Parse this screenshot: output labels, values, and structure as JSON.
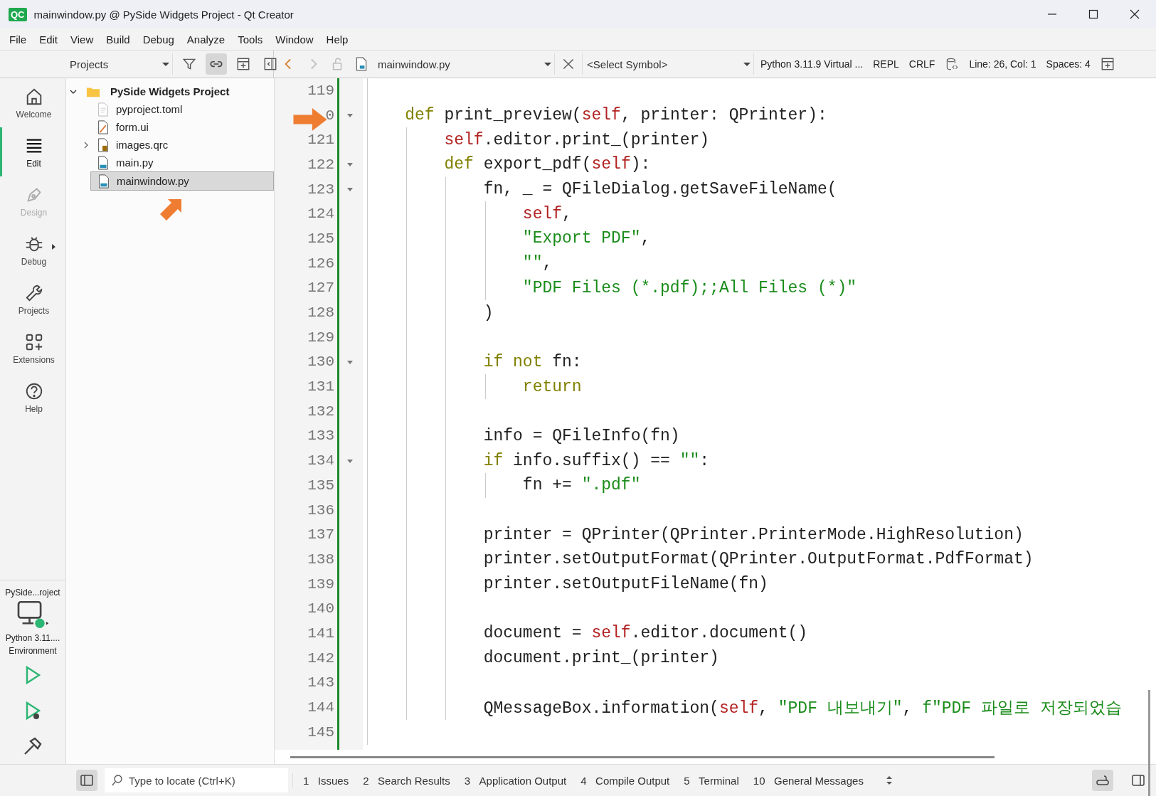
{
  "window": {
    "logo": "QC",
    "title": "mainwindow.py @ PySide Widgets Project - Qt Creator"
  },
  "menu": [
    "File",
    "Edit",
    "View",
    "Build",
    "Debug",
    "Analyze",
    "Tools",
    "Window",
    "Help"
  ],
  "project_toolbar": {
    "view": "Projects"
  },
  "editor_toolbar": {
    "file": "mainwindow.py",
    "symbol": "<Select Symbol>",
    "interpreter": "Python 3.11.9 Virtual ...",
    "repl": "REPL",
    "line_ending": "CRLF",
    "position": "Line: 26, Col: 1",
    "indentation": "Spaces: 4"
  },
  "modes": [
    {
      "label": "Welcome",
      "selected": false,
      "disabled": false,
      "menu": false
    },
    {
      "label": "Edit",
      "selected": true,
      "disabled": false,
      "menu": false
    },
    {
      "label": "Design",
      "selected": false,
      "disabled": true,
      "menu": false
    },
    {
      "label": "Debug",
      "selected": false,
      "disabled": false,
      "menu": true
    },
    {
      "label": "Projects",
      "selected": false,
      "disabled": false,
      "menu": false
    },
    {
      "label": "Extensions",
      "selected": false,
      "disabled": false,
      "menu": false
    },
    {
      "label": "Help",
      "selected": false,
      "disabled": false,
      "menu": false
    }
  ],
  "kit": {
    "project": "PySide...roject",
    "environment": "Python 3.11.... Environment"
  },
  "tree": {
    "label": "PySide Widgets Project",
    "expanded": true,
    "children": [
      {
        "label": "pyproject.toml",
        "kind": "toml",
        "collapsed": false,
        "selected": false
      },
      {
        "label": "form.ui",
        "kind": "ui",
        "collapsed": false,
        "selected": false
      },
      {
        "label": "images.qrc",
        "kind": "qrc",
        "collapsed": true,
        "selected": false
      },
      {
        "label": "main.py",
        "kind": "py",
        "collapsed": false,
        "selected": false
      },
      {
        "label": "mainwindow.py",
        "kind": "py",
        "collapsed": false,
        "selected": true
      }
    ]
  },
  "code": [
    {
      "number": "119",
      "fold": false
    },
    {
      "number": "0",
      "fold": true,
      "tokens": [
        {
          "kind": "keyword",
          "text": "    def"
        },
        {
          "kind": "plain",
          "text": " print_preview("
        },
        {
          "kind": "self",
          "text": "self"
        },
        {
          "kind": "plain",
          "text": ", printer: QPrinter):"
        }
      ]
    },
    {
      "number": "121",
      "fold": false,
      "tokens": [
        {
          "kind": "self",
          "text": "        self"
        },
        {
          "kind": "plain",
          "text": ".editor.print_(printer)"
        }
      ]
    },
    {
      "number": "122",
      "fold": true,
      "tokens": [
        {
          "kind": "keyword",
          "text": "        def"
        },
        {
          "kind": "plain",
          "text": " export_pdf("
        },
        {
          "kind": "self",
          "text": "self"
        },
        {
          "kind": "plain",
          "text": "):"
        }
      ]
    },
    {
      "number": "123",
      "fold": true,
      "tokens": [
        {
          "kind": "plain",
          "text": "            fn, _ = QFileDialog.getSaveFileName("
        }
      ]
    },
    {
      "number": "124",
      "fold": false,
      "tokens": [
        {
          "kind": "self",
          "text": "                self"
        },
        {
          "kind": "plain",
          "text": ","
        }
      ]
    },
    {
      "number": "125",
      "fold": false,
      "tokens": [
        {
          "kind": "string",
          "text": "                \"Export PDF\""
        },
        {
          "kind": "plain",
          "text": ","
        }
      ]
    },
    {
      "number": "126",
      "fold": false,
      "tokens": [
        {
          "kind": "string",
          "text": "                \"\""
        },
        {
          "kind": "plain",
          "text": ","
        }
      ]
    },
    {
      "number": "127",
      "fold": false,
      "tokens": [
        {
          "kind": "string",
          "text": "                \"PDF Files (*.pdf);;All Files (*)\""
        }
      ]
    },
    {
      "number": "128",
      "fold": false,
      "tokens": [
        {
          "kind": "plain",
          "text": "            )"
        }
      ]
    },
    {
      "number": "129",
      "fold": false
    },
    {
      "number": "130",
      "fold": true,
      "tokens": [
        {
          "kind": "keyword",
          "text": "            if not"
        },
        {
          "kind": "plain",
          "text": " fn:"
        }
      ]
    },
    {
      "number": "131",
      "fold": false,
      "tokens": [
        {
          "kind": "keyword",
          "text": "                return"
        }
      ]
    },
    {
      "number": "132",
      "fold": false
    },
    {
      "number": "133",
      "fold": false,
      "tokens": [
        {
          "kind": "plain",
          "text": "            info = QFileInfo(fn)"
        }
      ]
    },
    {
      "number": "134",
      "fold": true,
      "tokens": [
        {
          "kind": "keyword",
          "text": "            if"
        },
        {
          "kind": "plain",
          "text": " info.suffix() == "
        },
        {
          "kind": "string",
          "text": "\"\""
        },
        {
          "kind": "plain",
          "text": ":"
        }
      ]
    },
    {
      "number": "135",
      "fold": false,
      "tokens": [
        {
          "kind": "plain",
          "text": "                fn += "
        },
        {
          "kind": "string",
          "text": "\".pdf\""
        }
      ]
    },
    {
      "number": "136",
      "fold": false
    },
    {
      "number": "137",
      "fold": false,
      "tokens": [
        {
          "kind": "plain",
          "text": "            printer = QPrinter(QPrinter.PrinterMode.HighResolution)"
        }
      ]
    },
    {
      "number": "138",
      "fold": false,
      "tokens": [
        {
          "kind": "plain",
          "text": "            printer.setOutputFormat(QPrinter.OutputFormat.PdfFormat)"
        }
      ]
    },
    {
      "number": "139",
      "fold": false,
      "tokens": [
        {
          "kind": "plain",
          "text": "            printer.setOutputFileName(fn)"
        }
      ]
    },
    {
      "number": "140",
      "fold": false
    },
    {
      "number": "141",
      "fold": false,
      "tokens": [
        {
          "kind": "plain",
          "text": "            document = "
        },
        {
          "kind": "self",
          "text": "self"
        },
        {
          "kind": "plain",
          "text": ".editor.document()"
        }
      ]
    },
    {
      "number": "142",
      "fold": false,
      "tokens": [
        {
          "kind": "plain",
          "text": "            document.print_(printer)"
        }
      ]
    },
    {
      "number": "143",
      "fold": false
    },
    {
      "number": "144",
      "fold": false,
      "tokens": [
        {
          "kind": "plain",
          "text": "            QMessageBox.information("
        },
        {
          "kind": "self",
          "text": "self"
        },
        {
          "kind": "plain",
          "text": ", "
        },
        {
          "kind": "string",
          "text": "\"PDF 내보내기\""
        },
        {
          "kind": "plain",
          "text": ", "
        },
        {
          "kind": "string",
          "text": "f\"PDF 파일로 저장되었습"
        }
      ]
    },
    {
      "number": "145",
      "fold": false
    }
  ],
  "locator": {
    "placeholder": "Type to locate (Ctrl+K)"
  },
  "output_panes": [
    {
      "number": "1",
      "label": "Issues"
    },
    {
      "number": "2",
      "label": "Search Results"
    },
    {
      "number": "3",
      "label": "Application Output"
    },
    {
      "number": "4",
      "label": "Compile Output"
    },
    {
      "number": "5",
      "label": "Terminal"
    },
    {
      "number": "10",
      "label": "General Messages"
    }
  ]
}
